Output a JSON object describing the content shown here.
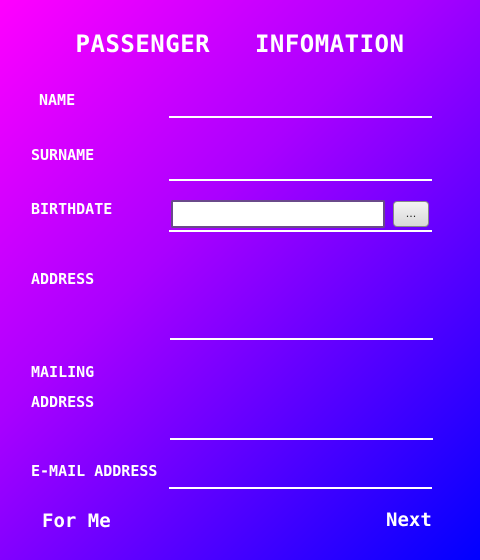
{
  "form": {
    "title": "PASSENGER   INFOMATION",
    "fields": {
      "name": {
        "label": "NAME"
      },
      "surname": {
        "label": "SURNAME"
      },
      "birthdate": {
        "label": "BIRTHDATE",
        "value": "",
        "picker_label": "..."
      },
      "address": {
        "label": "ADDRESS"
      },
      "mailing_address": {
        "label_line1": "MAILING",
        "label_line2": "ADDRESS"
      },
      "email": {
        "label": "E-MAIL ADDRESS"
      }
    },
    "buttons": {
      "for_me": "For Me",
      "next": "Next"
    }
  },
  "colors": {
    "gradient_start": "#ff00ff",
    "gradient_end": "#0000ff",
    "text": "#ffffff"
  }
}
